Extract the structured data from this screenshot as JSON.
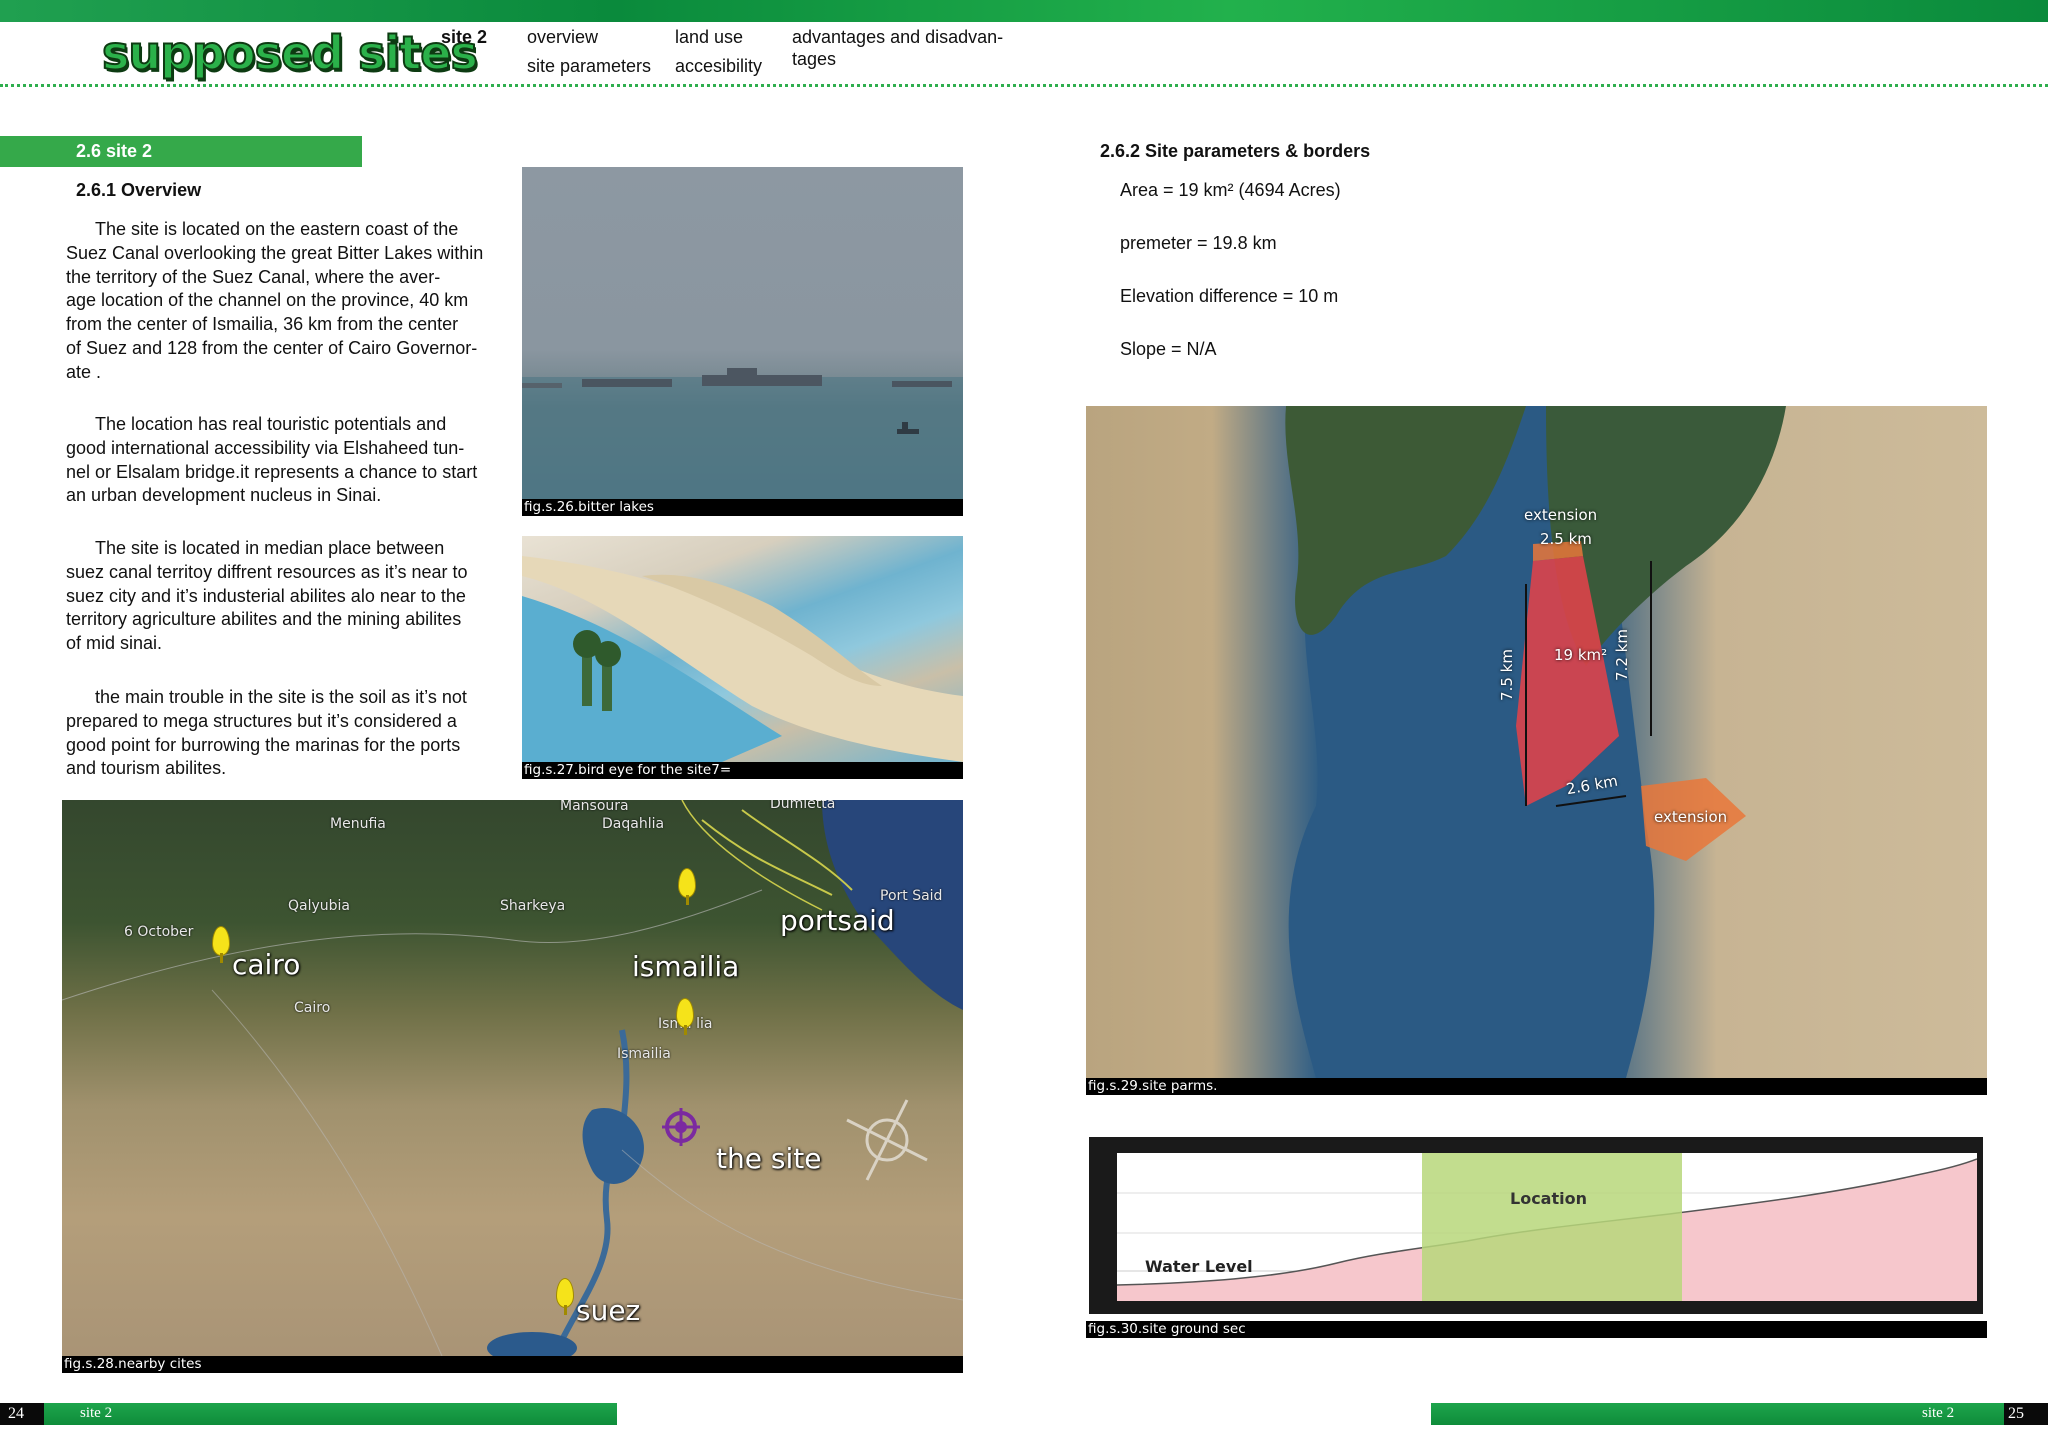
{
  "header": {
    "brand": "supposed sites",
    "nav": {
      "current": "site 2",
      "overview": "overview",
      "site_parameters": "site parameters",
      "land_use": "land use",
      "accesibility": "accesibility",
      "advantages_line1": "advantages and disadvan-",
      "advantages_line2": "tages"
    }
  },
  "left_page": {
    "section_bar": "2.6 site 2",
    "overview_heading": "2.6.1 Overview",
    "paragraphs": [
      [
        "The site is located on the eastern coast of the",
        "Suez Canal overlooking the great Bitter Lakes within",
        "the territory of the Suez Canal, where the aver-",
        "age location of the channel on the province, 40 km",
        "from the center of Ismailia, 36 km from the center",
        "of Suez and 128 from the center of Cairo Governor-",
        "ate ."
      ],
      [
        "The location has real touristic potentials and",
        "good international accessibility via Elshaheed tun-",
        "nel or Elsalam bridge.it represents a chance to start",
        "an urban development nucleus in Sinai."
      ],
      [
        "The site is located in median place between",
        "suez canal territoy diffrent resources as it’s near to",
        "suez city and it’s industerial abilites alo near to the",
        "territory agriculture abilites and the mining abilites",
        "of mid sinai."
      ],
      [
        "the main trouble in the site is the soil as it’s not",
        "prepared to mega structures but it’s considered a",
        "good point for burrowing the marinas for the ports",
        "and tourism abilites."
      ]
    ],
    "captions": {
      "lakes": "fig.s.26.bitter lakes",
      "bird": "fig.s.27.bird eye for the site7=",
      "map": "fig.s.28.nearby cites"
    },
    "map_labels": {
      "cairo": "cairo",
      "ismailia": "ismailia",
      "portsaid": "portsaid",
      "suez": "suez",
      "the_site": "the site",
      "menufia": "Menufia",
      "qalyubia": "Qalyubia",
      "sharkeya": "Sharkeya",
      "october": "6 October",
      "cairo_small": "Cairo",
      "ismailia_small": "Ismailia",
      "ismailia_small2": "Isma lia",
      "port_said_small": "Port Said",
      "mansoura": "Mansoura",
      "daqahlia": "Daqahlia",
      "damietta": "Dumietta"
    },
    "page_number": "24",
    "footer_label": "site 2"
  },
  "right_page": {
    "params_heading": "2.6.2 Site parameters & borders",
    "params": {
      "area": "Area = 19 km² (4694 Acres)",
      "perimeter": "premeter = 19.8 km",
      "elevation": "Elevation difference = 10 m",
      "slope": "Slope = N/A"
    },
    "site_labels": {
      "extension_top": "extension",
      "top_dim": "2.5 km",
      "left_dim": "7.5 km",
      "area": "19 km²",
      "right_dim": "7.2 km",
      "bottom_dim": "2.6 km",
      "extension_right": "extension"
    },
    "captions": {
      "site": "fig.s.29.site parms.",
      "profile": "fig.s.30.site ground sec"
    },
    "profile_labels": {
      "location": "Location",
      "water_level": "Water Level"
    },
    "page_number": "25",
    "footer_label": "site 2"
  },
  "colors": {
    "brand_green": "#2bb14a",
    "section_green": "#35a94a",
    "site_red": "#e0424a",
    "extension_orange": "#e9773a",
    "location_green": "#b7d77a",
    "profile_pink": "#f6c7cc"
  }
}
